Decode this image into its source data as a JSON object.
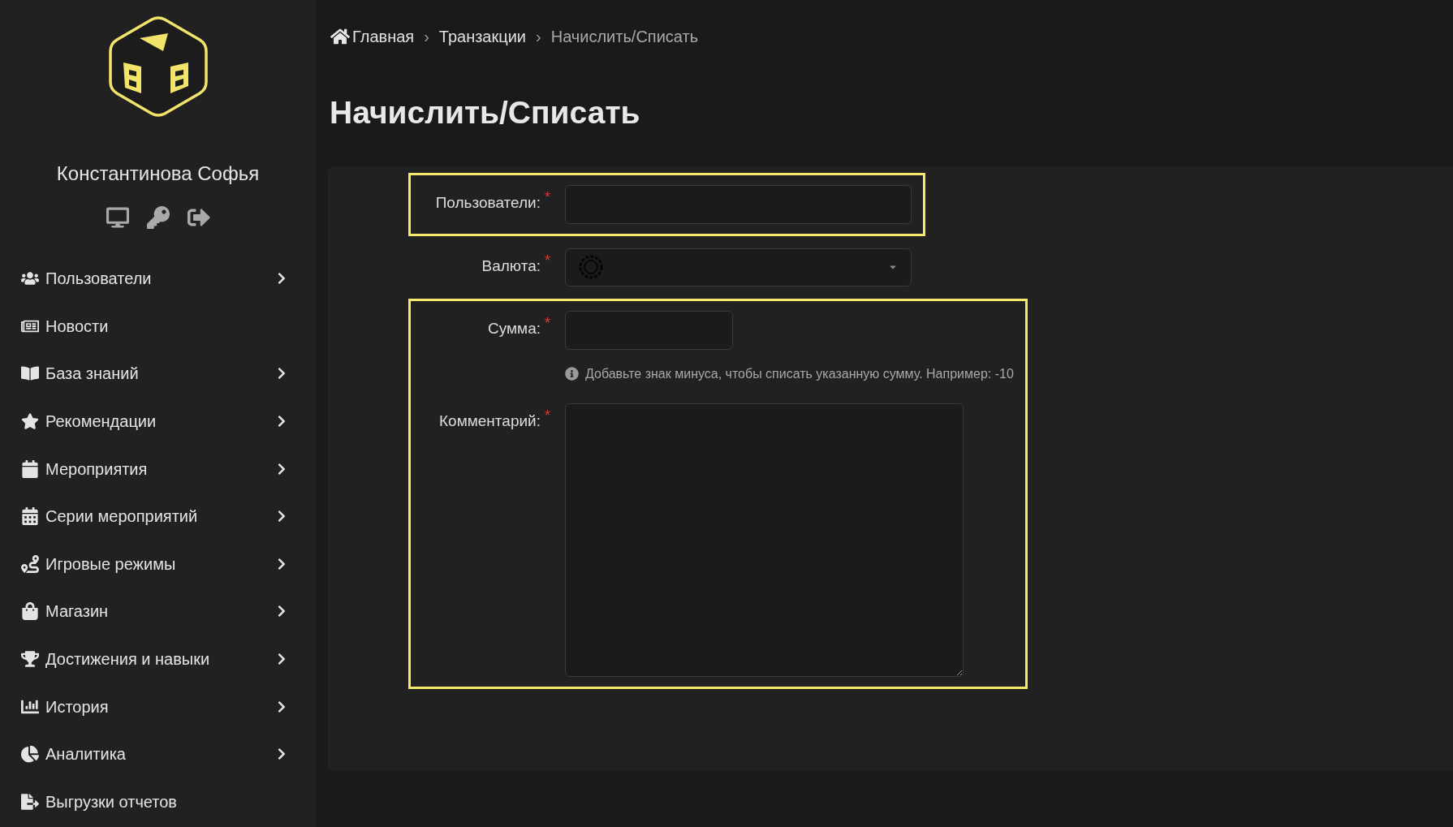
{
  "sidebar": {
    "user_name": "Константинова Софья",
    "items": [
      {
        "label": "Пользователи",
        "has_submenu": true
      },
      {
        "label": "Новости",
        "has_submenu": false
      },
      {
        "label": "База знаний",
        "has_submenu": true
      },
      {
        "label": "Рекомендации",
        "has_submenu": true
      },
      {
        "label": "Мероприятия",
        "has_submenu": true
      },
      {
        "label": "Серии мероприятий",
        "has_submenu": true
      },
      {
        "label": "Игровые режимы",
        "has_submenu": true
      },
      {
        "label": "Магазин",
        "has_submenu": true
      },
      {
        "label": "Достижения и навыки",
        "has_submenu": true
      },
      {
        "label": "История",
        "has_submenu": true
      },
      {
        "label": "Аналитика",
        "has_submenu": true
      },
      {
        "label": "Выгрузки отчетов",
        "has_submenu": false
      }
    ]
  },
  "breadcrumb": [
    {
      "label": "Главная",
      "current": false
    },
    {
      "label": "Транзакции",
      "current": false
    },
    {
      "label": "Начислить/Списать",
      "current": true
    }
  ],
  "breadcrumb_separator": "›",
  "page_title": "Начислить/Списать",
  "form": {
    "groups": [
      {
        "highlighted": true,
        "fields": [
          {
            "kind": "text",
            "label": "Пользователи:",
            "required_mark": "*"
          }
        ]
      },
      {
        "highlighted": false,
        "fields": [
          {
            "kind": "select",
            "label": "Валюта:",
            "required_mark": "*"
          }
        ]
      },
      {
        "highlighted": true,
        "fields": [
          {
            "kind": "number",
            "label": "Сумма:",
            "required_mark": "*",
            "hint": "Добавьте знак минуса, чтобы списать указанную сумму. Например: -10"
          },
          {
            "kind": "textarea",
            "label": "Комментарий:",
            "required_mark": "*"
          }
        ]
      }
    ]
  }
}
